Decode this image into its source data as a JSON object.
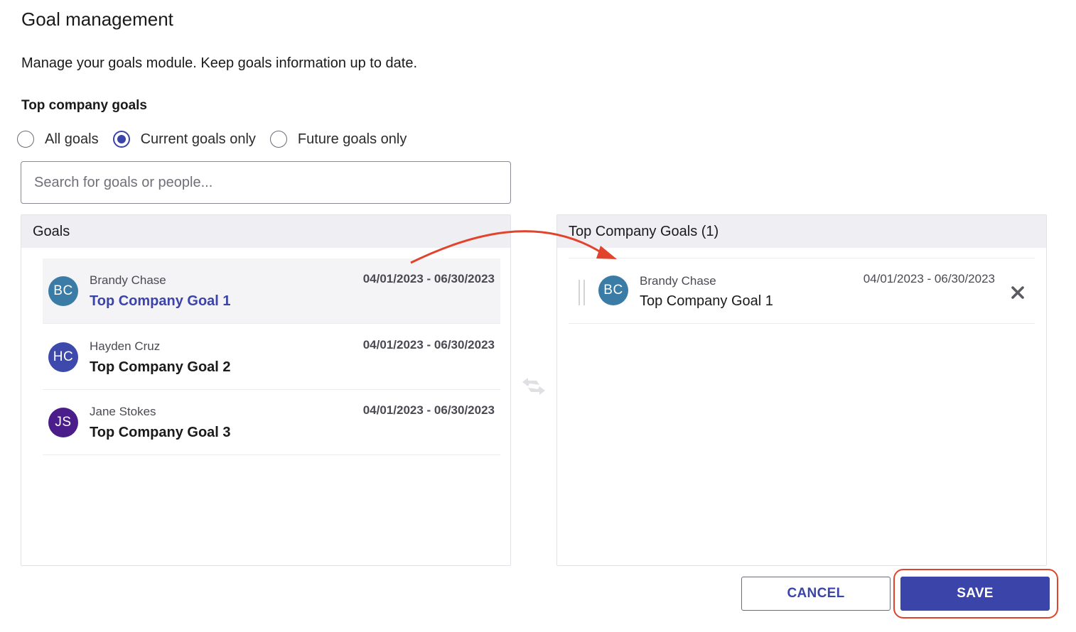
{
  "page": {
    "title": "Goal management",
    "description": "Manage your goals module. Keep goals information up to date.",
    "section_title": "Top company goals"
  },
  "filter": {
    "options": [
      {
        "label": "All goals",
        "checked": false
      },
      {
        "label": "Current goals only",
        "checked": true
      },
      {
        "label": "Future goals only",
        "checked": false
      }
    ]
  },
  "search": {
    "placeholder": "Search for goals or people..."
  },
  "goals_panel": {
    "header": "Goals",
    "items": [
      {
        "initials": "BC",
        "avatar_color": "#3a7ca5",
        "owner": "Brandy Chase",
        "title": "Top Company Goal 1",
        "dates": "04/01/2023 - 06/30/2023",
        "selected": true
      },
      {
        "initials": "HC",
        "avatar_color": "#3e4aab",
        "owner": "Hayden Cruz",
        "title": "Top Company Goal 2",
        "dates": "04/01/2023 - 06/30/2023",
        "selected": false
      },
      {
        "initials": "JS",
        "avatar_color": "#4a1d8a",
        "owner": "Jane Stokes",
        "title": "Top Company Goal 3",
        "dates": "04/01/2023 - 06/30/2023",
        "selected": false
      }
    ]
  },
  "top_goals_panel": {
    "header": "Top Company Goals (1)",
    "items": [
      {
        "initials": "BC",
        "avatar_color": "#3a7ca5",
        "owner": "Brandy Chase",
        "title": "Top Company Goal 1",
        "dates": "04/01/2023 - 06/30/2023"
      }
    ]
  },
  "actions": {
    "cancel_label": "CANCEL",
    "save_label": "SAVE"
  },
  "colors": {
    "accent": "#3b44a8",
    "annotation": "#e2432c"
  },
  "icons": {
    "swap": "swap-arrows-icon",
    "remove": "close-icon",
    "drag": "drag-handle-icon"
  }
}
